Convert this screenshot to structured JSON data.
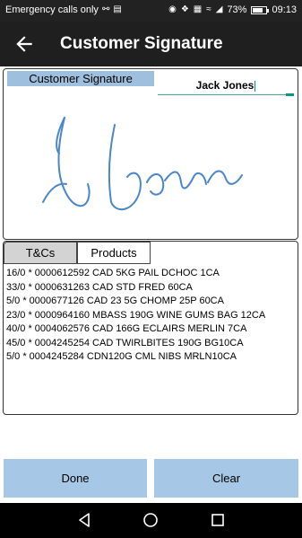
{
  "status_bar": {
    "carrier_text": "Emergency calls only",
    "battery": "73%",
    "time": "09:13",
    "battery_level": 0.73
  },
  "app_bar": {
    "title": "Customer Signature",
    "back_icon": "arrow-left-icon"
  },
  "signature": {
    "label": "Customer Signature",
    "name_value": "Jack Jones",
    "ink_color": "#4a86c8"
  },
  "tabs": [
    {
      "label": "T&Cs",
      "selected": true
    },
    {
      "label": "Products",
      "selected": false
    }
  ],
  "products": [
    "16/0 * 0000612592 CAD 5KG PAIL DCHOC 1CA",
    "33/0 * 0000631263 CAD STD FRED 60CA",
    "5/0 * 0000677126 CAD 23 5G CHOMP 25P 60CA",
    "23/0 * 0000964160 MBASS 190G WINE GUMS BAG 12CA",
    "40/0 * 0004062576 CAD 166G ECLAIRS MERLIN 7CA",
    "45/0 * 0004245254 CAD TWIRLBITES 190G BG10CA",
    "5/0 * 0004245284 CDN120G CML NIBS MRLN10CA"
  ],
  "buttons": {
    "done": "Done",
    "clear": "Clear"
  },
  "colors": {
    "button_bg": "#a6c8e6",
    "label_bg": "#9fbfde",
    "accent": "#009688"
  }
}
